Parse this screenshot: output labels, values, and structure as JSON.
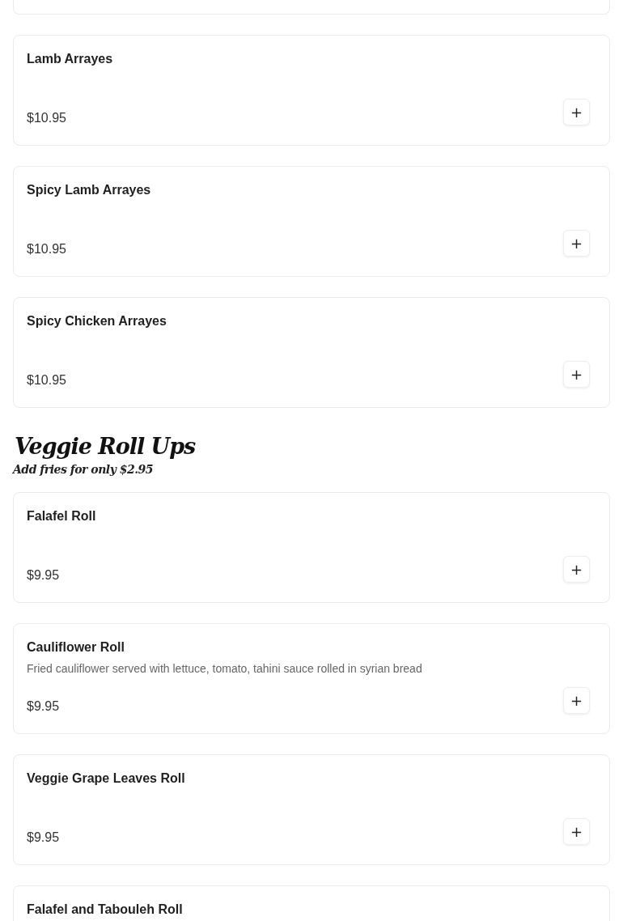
{
  "groups": [
    {
      "items": [
        {
          "kind": "edge"
        },
        {
          "kind": "item",
          "name": "Lamb Arrayes",
          "price": "$10.95",
          "add": "+"
        },
        {
          "kind": "item",
          "name": "Spicy Lamb Arrayes",
          "price": "$10.95",
          "add": "+"
        },
        {
          "kind": "item",
          "name": "Spicy Chicken Arrayes",
          "price": "$10.95",
          "add": "+"
        }
      ]
    },
    {
      "title": "Veggie Roll Ups",
      "subtitle": "Add fries for only $2.95",
      "items": [
        {
          "kind": "item",
          "name": "Falafel Roll",
          "price": "$9.95",
          "add": "+"
        },
        {
          "kind": "item",
          "name": "Cauliflower Roll",
          "description": "Fried cauliflower served with lettuce, tomato, tahini sauce rolled in syrian bread",
          "price": "$9.95",
          "add": "+"
        },
        {
          "kind": "item",
          "name": "Veggie Grape Leaves Roll",
          "price": "$9.95",
          "add": "+"
        },
        {
          "kind": "item",
          "name": "Falafel and Tabouleh Roll"
        }
      ]
    }
  ]
}
